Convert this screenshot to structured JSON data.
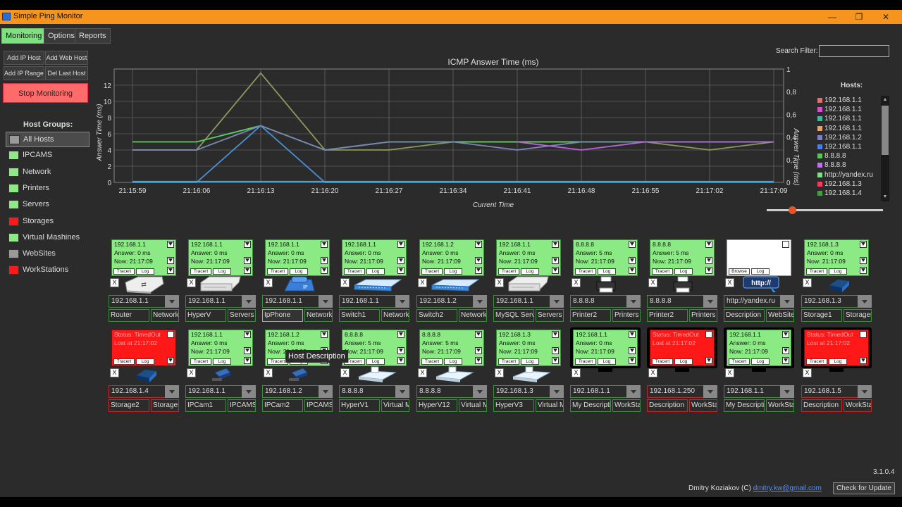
{
  "window": {
    "title": "Simple Ping Monitor",
    "minimize": "—",
    "maximize": "❐",
    "close": "✕"
  },
  "tabs": [
    {
      "label": "Monitoring"
    },
    {
      "label": "Options"
    },
    {
      "label": "Reports"
    }
  ],
  "side_buttons": {
    "add_ip_host": "Add IP Host",
    "add_web_host": "Add Web Host",
    "add_ip_range": "Add IP Range",
    "del_last_host": "Del Last Host"
  },
  "stop_monitoring": "Stop Monitoring",
  "host_groups": {
    "title": "Host Groups:",
    "items": [
      {
        "label": "All Hosts",
        "color": "#9a9a9a"
      },
      {
        "label": "IPCAMS",
        "color": "#8bea84"
      },
      {
        "label": "Network",
        "color": "#8bea84"
      },
      {
        "label": "Printers",
        "color": "#8bea84"
      },
      {
        "label": "Servers",
        "color": "#8bea84"
      },
      {
        "label": "Storages",
        "color": "#ff1818"
      },
      {
        "label": "Virtual Mashines",
        "color": "#8bea84"
      },
      {
        "label": "WebSites",
        "color": "#9a9a9a"
      },
      {
        "label": "WorkStations",
        "color": "#ff1818"
      }
    ]
  },
  "search": {
    "label": "Search Filter:",
    "value": ""
  },
  "hosts_legend": {
    "title": "Hosts:",
    "items": [
      {
        "label": "192.168.1.1",
        "color": "#e07070"
      },
      {
        "label": "192.168.1.1",
        "color": "#d050d0"
      },
      {
        "label": "192.168.1.1",
        "color": "#30c0a0"
      },
      {
        "label": "192.168.1.1",
        "color": "#f0a060"
      },
      {
        "label": "192.168.1.2",
        "color": "#8080c0"
      },
      {
        "label": "192.168.1.1",
        "color": "#4080f0"
      },
      {
        "label": "8.8.8.8",
        "color": "#60c060"
      },
      {
        "label": "8.8.8.8",
        "color": "#c070f0"
      },
      {
        "label": "http://yandex.ru",
        "color": "#80e080"
      },
      {
        "label": "192.168.1.3",
        "color": "#f04060"
      },
      {
        "label": "192.168.1.4",
        "color": "#40a040"
      }
    ]
  },
  "chart_data": {
    "type": "line",
    "title": "ICMP Answer Time (ms)",
    "xlabel": "Current Time",
    "ylabel": "Answer Time (ms)",
    "y2label": "Answer Time (ms)",
    "x": [
      "21:15:59",
      "21:16:06",
      "21:16:13",
      "21:16:20",
      "21:16:27",
      "21:16:34",
      "21:16:41",
      "21:16:48",
      "21:16:55",
      "21:17:02",
      "21:17:09"
    ],
    "ylim": [
      0,
      14
    ],
    "yticks": [
      "0",
      "2",
      "4",
      "6",
      "8",
      "10",
      "12"
    ],
    "y2ticks": [
      "0",
      "0,2",
      "0,4",
      "0,6",
      "0,8",
      "1"
    ],
    "grid": true,
    "series": [
      {
        "color": "#8a9a5b",
        "values": [
          4,
          4,
          13.5,
          4,
          4,
          5,
          5,
          5,
          5,
          4,
          5
        ]
      },
      {
        "color": "#5bd15b",
        "values": [
          5,
          5,
          7,
          4,
          5,
          5,
          5,
          5,
          5,
          5,
          5
        ]
      },
      {
        "color": "#7a86b8",
        "values": [
          4,
          4,
          7,
          4,
          5,
          5,
          4,
          5,
          5,
          5,
          5
        ]
      },
      {
        "color": "#b565d8",
        "values": [
          null,
          null,
          null,
          null,
          null,
          null,
          5,
          4,
          5,
          5,
          5
        ]
      },
      {
        "color": "#4a8fd6",
        "values": [
          0,
          0,
          7,
          0,
          0,
          0,
          0,
          0,
          0,
          0,
          0
        ]
      },
      {
        "color": "#3aa8d8",
        "values": [
          0.1,
          0.1,
          0.1,
          0.1,
          0.1,
          0.1,
          0.1,
          0.1,
          0.1,
          0.1,
          0.1
        ]
      }
    ]
  },
  "cards": [
    {
      "l1": "192.168.1.1",
      "l2": "Answer: 0 ms",
      "l3": "Now: 21:17:09",
      "status": "green",
      "ip": "192.168.1.1",
      "name": "Router",
      "group": "Network",
      "icon": "router"
    },
    {
      "l1": "192.168.1.1",
      "l2": "Answer: 0 ms",
      "l3": "Now: 21:17:09",
      "status": "green",
      "ip": "192.168.1.1",
      "name": "HyperV",
      "group": "Servers",
      "icon": "server"
    },
    {
      "l1": "192.168.1.1",
      "l2": "Answer: 0 ms",
      "l3": "Now: 21:17:09",
      "status": "green",
      "ip": "192.168.1.1",
      "name": "IpPhone",
      "group": "Network",
      "icon": "phone"
    },
    {
      "l1": "192.168.1.1",
      "l2": "Answer: 0 ms",
      "l3": "Now: 21:17:09",
      "status": "green",
      "ip": "192.168.1.1",
      "name": "Switch1",
      "group": "Network",
      "icon": "switch"
    },
    {
      "l1": "192.168.1.2",
      "l2": "Answer: 0 ms",
      "l3": "Now: 21:17:09",
      "status": "green",
      "ip": "192.168.1.2",
      "name": "Switch2",
      "group": "Network",
      "icon": "switch"
    },
    {
      "l1": "192.168.1.1",
      "l2": "Answer: 0 ms",
      "l3": "Now: 21:17:09",
      "status": "green",
      "ip": "192.168.1.1",
      "name": "MySQL Server",
      "group": "Servers",
      "icon": "server"
    },
    {
      "l1": "8.8.8.8",
      "l2": "Answer: 5 ms",
      "l3": "Now: 21:17:09",
      "status": "green",
      "ip": "8.8.8.8",
      "name": "Printer2",
      "group": "Printers",
      "icon": "printer"
    },
    {
      "l1": "8.8.8.8",
      "l2": "Answer: 5 ms",
      "l3": "Now: 21:17:09",
      "status": "green",
      "ip": "8.8.8.8",
      "name": "Printer2",
      "group": "Printers",
      "icon": "printer"
    },
    {
      "l1": "",
      "l2": "",
      "l3": "",
      "status": "web",
      "ip": "http://yandex.ru",
      "name": "Description",
      "group": "WebSites",
      "icon": "web",
      "browse": "Browse",
      "web_text": "http://"
    },
    {
      "l1": "192.168.1.3",
      "l2": "Answer: 0 ms",
      "l3": "Now: 21:17:09",
      "status": "green",
      "ip": "192.168.1.3",
      "name": "Storage1",
      "group": "Storages",
      "icon": "storage"
    },
    {
      "l1": "Status: TimedOut",
      "l2": "Lost at 21:17:02",
      "l3": "",
      "status": "red",
      "ip": "192.168.1.4",
      "name": "Storage2",
      "group": "Storages",
      "icon": "storage"
    },
    {
      "l1": "192.168.1.1",
      "l2": "Answer: 0 ms",
      "l3": "Now: 21:17:09",
      "status": "green",
      "ip": "192.168.1.1",
      "name": "IPCam1",
      "group": "IPCAMS",
      "icon": "camera"
    },
    {
      "l1": "192.168.1.2",
      "l2": "Answer: 0 ms",
      "l3": "Now: 21:17:09",
      "status": "green",
      "ip": "192.168.1.2",
      "name": "IPCam2",
      "group": "IPCAMS",
      "icon": "camera"
    },
    {
      "l1": "8.8.8.8",
      "l2": "Answer: 5 ms",
      "l3": "Now: 21:17:09",
      "status": "green",
      "ip": "8.8.8.8",
      "name": "HyperV1",
      "group": "Virtual Mashines",
      "icon": "vm"
    },
    {
      "l1": "8.8.8.8",
      "l2": "Answer: 5 ms",
      "l3": "Now: 21:17:09",
      "status": "green",
      "ip": "8.8.8.8",
      "name": "HyperV12",
      "group": "Virtual Mashines",
      "icon": "vm"
    },
    {
      "l1": "192.168.1.3",
      "l2": "Answer: 0 ms",
      "l3": "Now: 21:17:09",
      "status": "green",
      "ip": "192.168.1.3",
      "name": "HyperV3",
      "group": "Virtual Mashines",
      "icon": "vm"
    },
    {
      "l1": "192.168.1.1",
      "l2": "Answer: 0 ms",
      "l3": "Now: 21:17:09",
      "status": "green",
      "ip": "192.168.1.1",
      "name": "My Description",
      "group": "WorkStations",
      "icon": "monitor"
    },
    {
      "l1": "Status: TimedOut",
      "l2": "Lost at 21:17:02",
      "l3": "",
      "status": "red",
      "ip": "192.168.1.250",
      "name": "Description",
      "group": "WorkStations",
      "icon": "monitor"
    },
    {
      "l1": "192.168.1.1",
      "l2": "Answer: 0 ms",
      "l3": "Now: 21:17:09",
      "status": "green",
      "ip": "192.168.1.1",
      "name": "My Description",
      "group": "WorkStations",
      "icon": "monitor"
    },
    {
      "l1": "Status: TimedOut",
      "l2": "Lost at 21:17:02",
      "l3": "",
      "status": "red",
      "ip": "192.168.1.5",
      "name": "Description",
      "group": "WorkStations",
      "icon": "monitor"
    }
  ],
  "card_buttons": {
    "tracert": "Tracert",
    "log": "Log",
    "remove": "X"
  },
  "tooltip": "Host Description",
  "footer": {
    "version": "3.1.0.4",
    "author": "Dmitry Koziakov (C)",
    "email": "dmitry.kw@gmail.com",
    "update": "Check for Update"
  }
}
